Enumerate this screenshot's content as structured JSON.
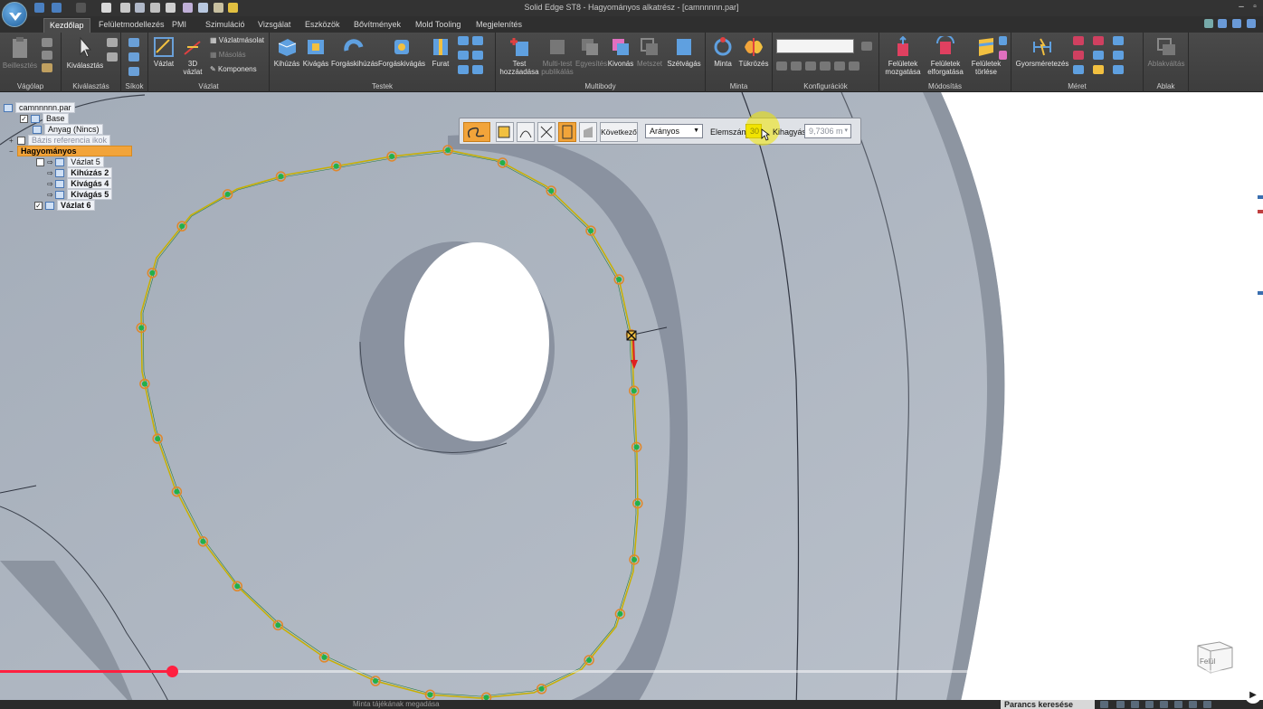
{
  "window": {
    "title": "Solid Edge ST8 - Hagyományos alkatrész - [camnnnnn.par]",
    "controls": [
      "minimize-icon",
      "restore-icon",
      "close-icon"
    ]
  },
  "tabs": [
    {
      "label": "Kezdőlap",
      "active": true
    },
    {
      "label": "Felületmodellezés"
    },
    {
      "label": "PMI"
    },
    {
      "label": "Szimuláció"
    },
    {
      "label": "Vizsgálat"
    },
    {
      "label": "Eszközök"
    },
    {
      "label": "Bővítmények"
    },
    {
      "label": "Mold Tooling"
    },
    {
      "label": "Megjelenítés"
    }
  ],
  "ribbon": {
    "vagolap": {
      "label": "Vágólap",
      "beillesztes": "Beillesztés"
    },
    "kivalasztas": {
      "label": "Kiválasztás",
      "kivalasztas": "Kiválasztás"
    },
    "sikok": {
      "label": "Síkok"
    },
    "vazlat": {
      "label": "Vázlat",
      "vazlat": "Vázlat",
      "vazlat3d_1": "3D",
      "vazlat3d_2": "vázlat",
      "vazlatmasolat": "Vázlatmásolat",
      "masolas": "Másolás",
      "komponens": "Komponens"
    },
    "testek": {
      "label": "Testek",
      "kihuzas": "Kihúzás",
      "kivagas": "Kivágás",
      "forgaskihuzas": "Forgáskihúzás",
      "forgaskivagas": "Forgáskivágás",
      "furat": "Furat"
    },
    "multibody": {
      "label": "Multibody",
      "test_hozzaadasa_1": "Test",
      "test_hozzaadasa_2": "hozzáadása",
      "multi_test_1": "Multi-test",
      "multi_test_2": "publikálás",
      "egyesites": "Egyesítés",
      "kivonas": "Kivonás",
      "metszet": "Metszet",
      "szetvagas": "Szétvágás"
    },
    "minta": {
      "label": "Minta",
      "minta": "Minta",
      "tukrozes": "Tükrözés"
    },
    "konfiguraciok": {
      "label": "Konfigurációk"
    },
    "modositas": {
      "label": "Módosítás",
      "mozgatas_1": "Felületek",
      "mozgatas_2": "mozgatása",
      "elforgatas_1": "Felületek",
      "elforgatas_2": "elforgatása",
      "torles_1": "Felületek",
      "torles_2": "törlése"
    },
    "meret": {
      "label": "Méret",
      "gyorsmeretezes": "Gyorsméretezés"
    },
    "ablak": {
      "label": "Ablak",
      "ablakvaltas": "Ablakváltás"
    }
  },
  "pathfinder": {
    "nodes": [
      {
        "name": "tree-root",
        "label": "camnnnnn.par"
      },
      {
        "name": "tree-base",
        "label": "Base"
      },
      {
        "name": "tree-anyag",
        "label": "Anyag (Nincs)"
      },
      {
        "name": "tree-bazis",
        "label": "Bázis referencia ikok"
      },
      {
        "name": "tree-hagyomanyos",
        "label": "Hagyományos"
      },
      {
        "name": "tree-vazlat5",
        "label": "Vázlat 5"
      },
      {
        "name": "tree-kihuzas2",
        "label": "Kihúzás 2"
      },
      {
        "name": "tree-kivagas4",
        "label": "Kivágás 4"
      },
      {
        "name": "tree-kivagas5",
        "label": "Kivágás 5"
      },
      {
        "name": "tree-vazlat6",
        "label": "Vázlat 6"
      }
    ]
  },
  "command_bar": {
    "next_button": "Következő",
    "mode": "Arányos",
    "count_label": "Elemszám:",
    "count_value": "30",
    "spacing_label": "Kihagyás:",
    "spacing_value": "9,7306 m"
  },
  "status": {
    "message": "Minta tájékának megadása",
    "search": "Parancs keresése"
  },
  "video": {
    "progress": 0.136
  },
  "viewcube": {
    "label": "Felül"
  },
  "colors": {
    "accent_orange": "#f2a43a",
    "point_green": "#22b04a",
    "point_ring": "#e0872a",
    "progress_red": "#ff2040"
  }
}
